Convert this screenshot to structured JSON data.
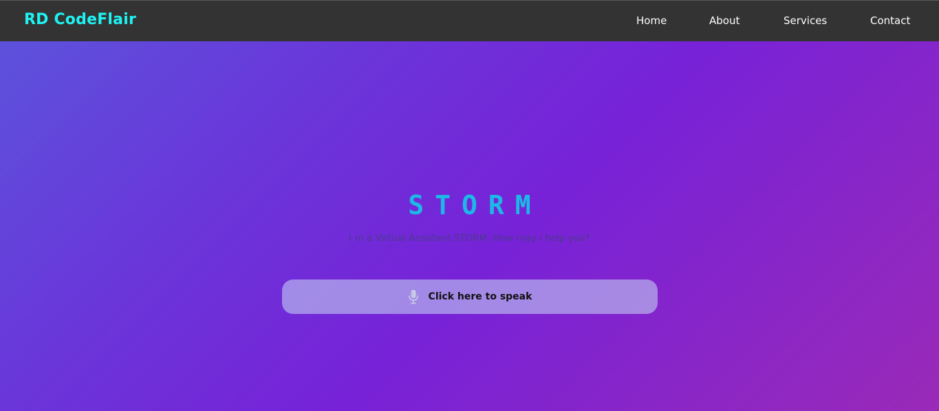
{
  "nav": {
    "brand": "RD CodeFlair",
    "links": [
      {
        "label": "Home"
      },
      {
        "label": "About"
      },
      {
        "label": "Services"
      },
      {
        "label": "Contact"
      }
    ]
  },
  "hero": {
    "title": "STORM",
    "subtitle": "I m a Virtual Assistant STORM, How may i help you?",
    "speak_button": {
      "label": "Click here to speak",
      "icon": "microphone-icon"
    }
  },
  "colors": {
    "navbar_bg": "#333333",
    "brand": "#1ff2f2",
    "title": "#1cb8e6",
    "gradient_start": "#5b55dd",
    "gradient_end": "#9a2ab8"
  }
}
